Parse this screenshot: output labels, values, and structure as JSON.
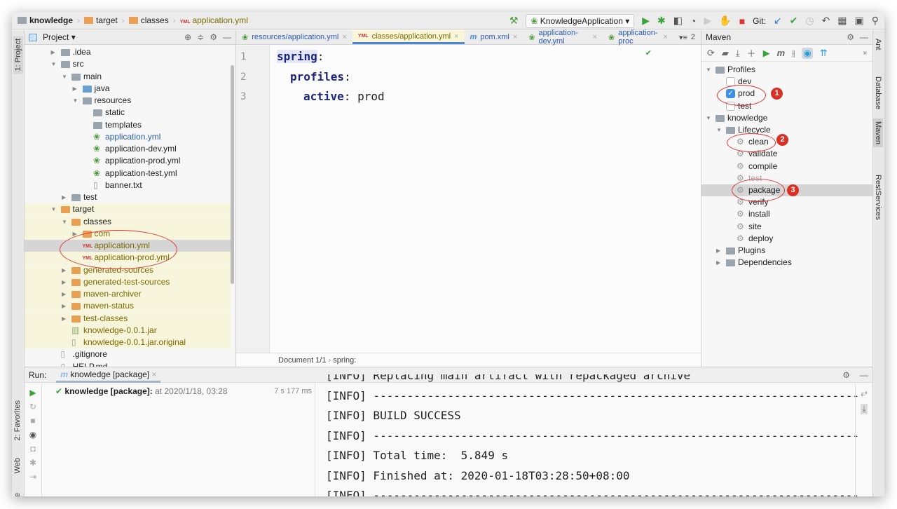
{
  "breadcrumb": [
    {
      "label": "knowledge",
      "icon": "module"
    },
    {
      "label": "target",
      "icon": "folder"
    },
    {
      "label": "classes",
      "icon": "folder"
    },
    {
      "label": "application.yml",
      "icon": "yml"
    }
  ],
  "toolbar": {
    "run_config": "KnowledgeApplication",
    "git_label": "Git:"
  },
  "left_strip": {
    "project": "1: Project",
    "favorites": "2: Favorites",
    "web": "Web",
    "structure": "ucture"
  },
  "right_strip": {
    "ant": "Ant",
    "database": "Database",
    "maven": "Maven",
    "rest": "RestServices"
  },
  "project": {
    "title": "Project",
    "tree": [
      {
        "text": ".idea",
        "lvl": 1,
        "arrow": "right",
        "type": "folder-gray"
      },
      {
        "text": "src",
        "lvl": 1,
        "arrow": "down",
        "type": "folder-gray"
      },
      {
        "text": "main",
        "lvl": 2,
        "arrow": "down",
        "type": "folder-gray"
      },
      {
        "text": "java",
        "lvl": 3,
        "arrow": "right",
        "type": "folder-blue"
      },
      {
        "text": "resources",
        "lvl": 3,
        "arrow": "down",
        "type": "folder-gray"
      },
      {
        "text": "static",
        "lvl": 4,
        "type": "folder-gray"
      },
      {
        "text": "templates",
        "lvl": 4,
        "type": "folder-gray"
      },
      {
        "text": "application.yml",
        "lvl": 4,
        "type": "yml-green",
        "color": "#2a5db0"
      },
      {
        "text": "application-dev.yml",
        "lvl": 4,
        "type": "yml-green"
      },
      {
        "text": "application-prod.yml",
        "lvl": 4,
        "type": "yml-green"
      },
      {
        "text": "application-test.yml",
        "lvl": 4,
        "type": "yml-green"
      },
      {
        "text": "banner.txt",
        "lvl": 4,
        "type": "file"
      },
      {
        "text": "test",
        "lvl": 2,
        "arrow": "right",
        "type": "folder-gray"
      },
      {
        "text": "target",
        "lvl": 1,
        "arrow": "down",
        "type": "folder"
      },
      {
        "text": "classes",
        "lvl": 2,
        "arrow": "down",
        "type": "folder"
      },
      {
        "text": "com",
        "lvl": 3,
        "arrow": "right",
        "type": "folder",
        "color": "#7a6b00"
      },
      {
        "text": "application.yml",
        "lvl": 3,
        "type": "yml",
        "color": "#7a6b00",
        "selected": true
      },
      {
        "text": "application-prod.yml",
        "lvl": 3,
        "type": "yml",
        "color": "#7a6b00"
      },
      {
        "text": "generated-sources",
        "lvl": 2,
        "arrow": "right",
        "type": "folder",
        "color": "#7a6b00"
      },
      {
        "text": "generated-test-sources",
        "lvl": 2,
        "arrow": "right",
        "type": "folder",
        "color": "#7a6b00"
      },
      {
        "text": "maven-archiver",
        "lvl": 2,
        "arrow": "right",
        "type": "folder",
        "color": "#7a6b00"
      },
      {
        "text": "maven-status",
        "lvl": 2,
        "arrow": "right",
        "type": "folder",
        "color": "#7a6b00"
      },
      {
        "text": "test-classes",
        "lvl": 2,
        "arrow": "right",
        "type": "folder",
        "color": "#7a6b00"
      },
      {
        "text": "knowledge-0.0.1.jar",
        "lvl": 2,
        "type": "jar",
        "color": "#7a6b00"
      },
      {
        "text": "knowledge-0.0.1.jar.original",
        "lvl": 2,
        "type": "file",
        "color": "#7a6b00"
      },
      {
        "text": ".gitignore",
        "lvl": 1,
        "type": "file"
      },
      {
        "text": "HELP.md",
        "lvl": 1,
        "type": "file"
      }
    ]
  },
  "editor": {
    "tabs": [
      {
        "label": "resources/application.yml",
        "icon": "yml-green"
      },
      {
        "label": "classes/application.yml",
        "icon": "yml",
        "active": true
      },
      {
        "label": "pom.xml",
        "icon": "maven"
      },
      {
        "label": "application-dev.yml",
        "icon": "yml-green"
      },
      {
        "label": "application-proc",
        "icon": "yml-green"
      }
    ],
    "more_tabs": "2",
    "lines": [
      {
        "n": "1",
        "key": "spring",
        "val": ""
      },
      {
        "n": "2",
        "key": "profiles",
        "val": ""
      },
      {
        "n": "3",
        "key": "active",
        "val": " prod"
      }
    ],
    "status_doc": "Document 1/1",
    "status_path": "spring:"
  },
  "maven": {
    "title": "Maven",
    "tree": [
      {
        "text": "Profiles",
        "lvl": 0,
        "arrow": "down",
        "type": "profiles"
      },
      {
        "text": "dev",
        "lvl": 1,
        "type": "checkbox",
        "checked": false
      },
      {
        "text": "prod",
        "lvl": 1,
        "type": "checkbox",
        "checked": true
      },
      {
        "text": "test",
        "lvl": 1,
        "type": "checkbox",
        "checked": false
      },
      {
        "text": "knowledge",
        "lvl": 0,
        "arrow": "down",
        "type": "module"
      },
      {
        "text": "Lifecycle",
        "lvl": 1,
        "arrow": "down",
        "type": "folder-gray"
      },
      {
        "text": "clean",
        "lvl": 2,
        "type": "gear"
      },
      {
        "text": "validate",
        "lvl": 2,
        "type": "gear"
      },
      {
        "text": "compile",
        "lvl": 2,
        "type": "gear"
      },
      {
        "text": "test",
        "lvl": 2,
        "type": "gear",
        "color": "#aaa"
      },
      {
        "text": "package",
        "lvl": 2,
        "type": "gear",
        "selected": true
      },
      {
        "text": "verify",
        "lvl": 2,
        "type": "gear"
      },
      {
        "text": "install",
        "lvl": 2,
        "type": "gear"
      },
      {
        "text": "site",
        "lvl": 2,
        "type": "gear"
      },
      {
        "text": "deploy",
        "lvl": 2,
        "type": "gear"
      },
      {
        "text": "Plugins",
        "lvl": 1,
        "arrow": "right",
        "type": "folder-gray"
      },
      {
        "text": "Dependencies",
        "lvl": 1,
        "arrow": "right",
        "type": "folder-gray"
      }
    ]
  },
  "annotations": [
    "1",
    "2",
    "3"
  ],
  "run": {
    "label": "Run:",
    "tab": "knowledge [package]",
    "item_name": "knowledge [package]:",
    "item_time": "at 2020/1/18, 03:28",
    "duration": "7 s 177 ms",
    "console": [
      "[INFO] Replacing main artifact with repackaged archive",
      "[INFO] ------------------------------------------------------------------------",
      "[INFO] BUILD SUCCESS",
      "[INFO] ------------------------------------------------------------------------",
      "[INFO] Total time:  5.849 s",
      "[INFO] Finished at: 2020-01-18T03:28:50+08:00",
      "[INFO] ------------------------------------------------------------------------"
    ]
  },
  "colors": {
    "accent": "#4a88d8",
    "annotation": "#d93025",
    "keyword": "#1a237e",
    "target_bg": "#f7f5dc"
  }
}
